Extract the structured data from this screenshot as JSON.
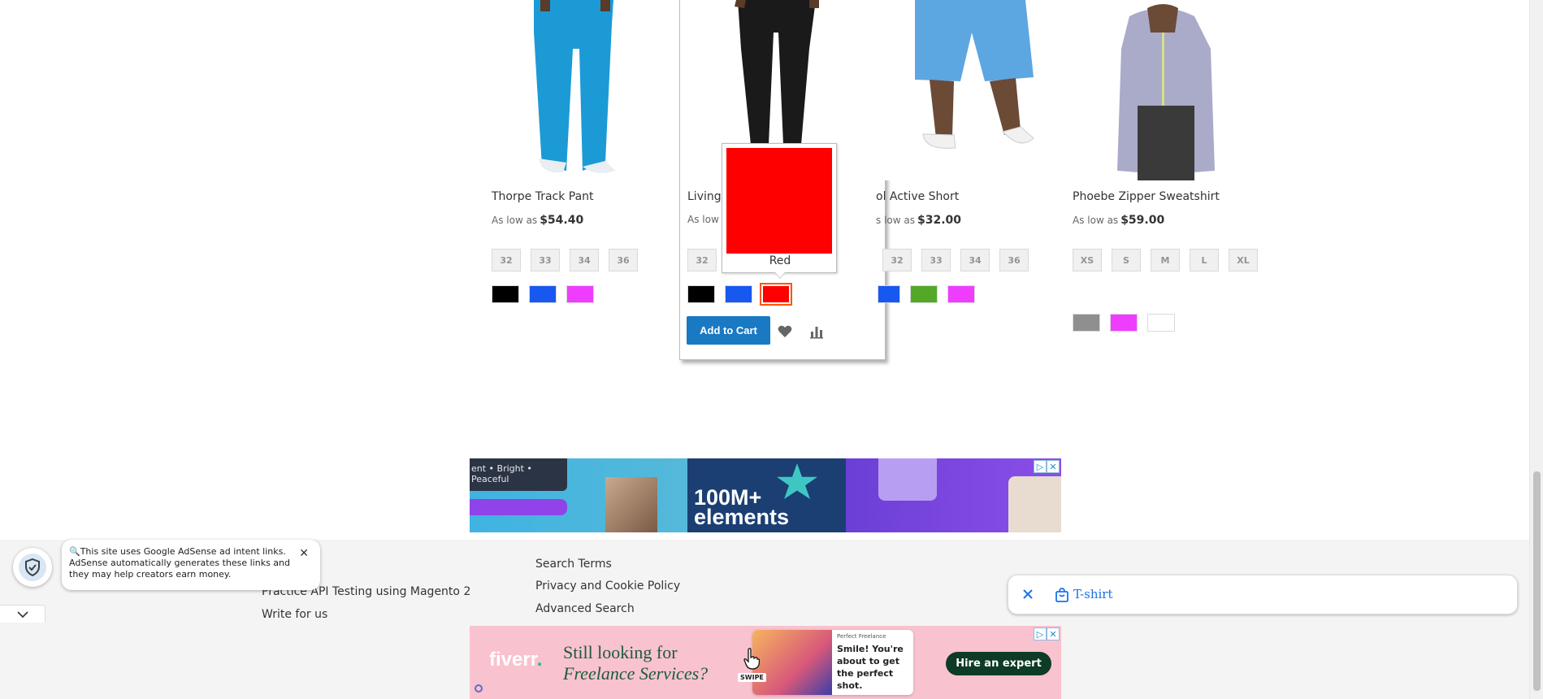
{
  "products": [
    {
      "name": "Thorpe Track Pant",
      "as_low_as": "As low as",
      "price": "$54.40",
      "sizes": [
        "32",
        "33",
        "34",
        "36"
      ],
      "colors": [
        "#000000",
        "#1758f0",
        "#ef3dff"
      ]
    },
    {
      "name": "Livingston All-Purpose Tight",
      "name_visible": "Livings",
      "as_low_as": "As low a",
      "price": "",
      "sizes": [
        "32"
      ],
      "colors": [
        "#000000",
        "#1758f0",
        "#ff0000"
      ]
    },
    {
      "name_visible": "ol Active Short",
      "as_low_as": "s low as",
      "price": "$32.00",
      "sizes": [
        "32",
        "33",
        "34",
        "36"
      ],
      "colors": [
        "#1758f0",
        "#53a828",
        "#ef3dff"
      ]
    },
    {
      "name": "Phoebe Zipper Sweatshirt",
      "as_low_as": "As low as",
      "price": "$59.00",
      "sizes": [
        "XS",
        "S",
        "M",
        "L",
        "XL"
      ],
      "colors": [
        "#8f8f8f",
        "#ef3dff",
        "#ffffff"
      ]
    }
  ],
  "hover_card": {
    "add_to_cart": "Add to Cart",
    "wishlist_icon": "heart-icon",
    "compare_icon": "bar-chart-icon"
  },
  "tooltip": {
    "label": "Red",
    "color": "#ff0000"
  },
  "ad_top": {
    "tagline": "ent • Bright • Peaceful",
    "headline": "100M+ elements"
  },
  "footer": {
    "links_left": [
      "Practice API Testing using Magento 2",
      "Write for us"
    ],
    "links_right": [
      "Search Terms",
      "Privacy and Cookie Policy",
      "Advanced Search"
    ]
  },
  "adsense_notice": {
    "text": "This site uses Google AdSense ad intent links. AdSense automatically generates these links and they may help creators earn money."
  },
  "search_chip": {
    "query": "T-shirt"
  },
  "ad_bottom": {
    "logo": "fiverr",
    "headline_1": "Still looking for",
    "headline_2": "Freelance Services?",
    "card_meta": "Perfect Freelance",
    "card_text": "Smile! You're about to get the perfect shot.",
    "swipe": "SWIPE",
    "cta": "Hire an expert"
  },
  "accent_color": "#1979c3"
}
